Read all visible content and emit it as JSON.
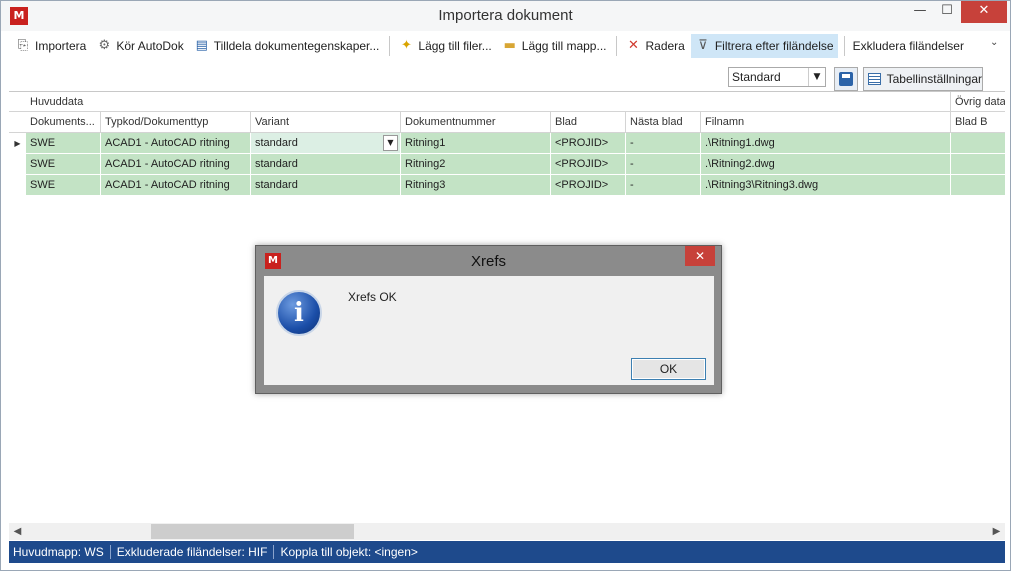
{
  "window": {
    "title": "Importera dokument",
    "app_icon": "M",
    "min": "—",
    "max": "☐",
    "close": "✕"
  },
  "toolbar": {
    "items": [
      {
        "label": "Importera",
        "icon": "import-icon"
      },
      {
        "label": "Kör AutoDok",
        "icon": "gears-icon"
      },
      {
        "label": "Tilldela dokumentegenskaper...",
        "icon": "properties-icon"
      },
      {
        "label": "Lägg till filer...",
        "icon": "add-file-icon"
      },
      {
        "label": "Lägg till mapp...",
        "icon": "folder-icon"
      },
      {
        "label": "Radera",
        "icon": "delete-icon"
      },
      {
        "label": "Filtrera efter filändelse",
        "icon": "filter-icon"
      },
      {
        "label": "Exkludera filändelser",
        "icon": ""
      }
    ],
    "more": "⌄"
  },
  "row2": {
    "layout_select": "Standard",
    "table_settings": "Tabellinställningar"
  },
  "grid": {
    "bands": [
      "Huvuddata",
      "Övrig data"
    ],
    "columns": [
      "Dokuments...",
      "Typkod/Dokumenttyp",
      "Variant",
      "Dokumentnummer",
      "Blad",
      "Nästa blad",
      "Filnamn",
      "Blad B"
    ],
    "rows": [
      [
        "SWE",
        "ACAD1 - AutoCAD ritning",
        "standard",
        "Ritning1",
        "<PROJID>",
        "-",
        ".\\Ritning1.dwg",
        ""
      ],
      [
        "SWE",
        "ACAD1 - AutoCAD ritning",
        "standard",
        "Ritning2",
        "<PROJID>",
        "-",
        ".\\Ritning2.dwg",
        ""
      ],
      [
        "SWE",
        "ACAD1 - AutoCAD ritning",
        "standard",
        "Ritning3",
        "<PROJID>",
        "-",
        ".\\Ritning3\\Ritning3.dwg",
        ""
      ]
    ],
    "row_color": "#c3e3c5"
  },
  "statusbar": {
    "items": [
      "Huvudmapp: WS",
      "Exkluderade filändelser: HIF",
      "Koppla till objekt: <ingen>"
    ],
    "color": "#1e4a8c"
  },
  "dialog": {
    "title": "Xrefs",
    "message": "Xrefs OK",
    "ok": "OK",
    "close": "✕",
    "icon": "info-icon",
    "info_glyph": "i"
  }
}
